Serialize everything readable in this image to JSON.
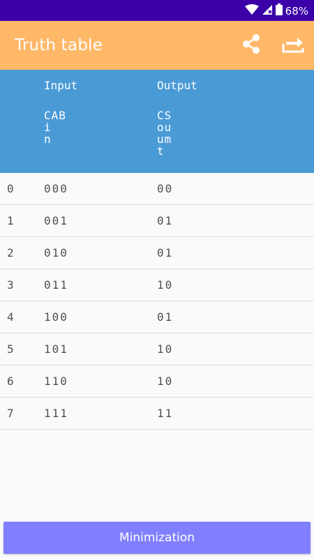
{
  "status_bar": {
    "battery_percent": "68%",
    "icons": [
      "wifi-icon",
      "signal-icon",
      "battery-icon"
    ]
  },
  "app_bar": {
    "title": "Truth table",
    "actions": [
      "share-icon",
      "export-icon"
    ]
  },
  "colors": {
    "status_bar": "#3b00a8",
    "app_bar": "#ffb868",
    "header": "#4a9ad6",
    "button": "#8080ff"
  },
  "table": {
    "input_label": "Input",
    "output_label": "Output",
    "input_vars": "CAB\ni\nn",
    "output_vars": "CS\nou\num\nt",
    "rows": [
      {
        "index": "0",
        "input": "000",
        "output": "00"
      },
      {
        "index": "1",
        "input": "001",
        "output": "01"
      },
      {
        "index": "2",
        "input": "010",
        "output": "01"
      },
      {
        "index": "3",
        "input": "011",
        "output": "10"
      },
      {
        "index": "4",
        "input": "100",
        "output": "01"
      },
      {
        "index": "5",
        "input": "101",
        "output": "10"
      },
      {
        "index": "6",
        "input": "110",
        "output": "10"
      },
      {
        "index": "7",
        "input": "111",
        "output": "11"
      }
    ]
  },
  "footer": {
    "minimization_label": "Minimization"
  }
}
